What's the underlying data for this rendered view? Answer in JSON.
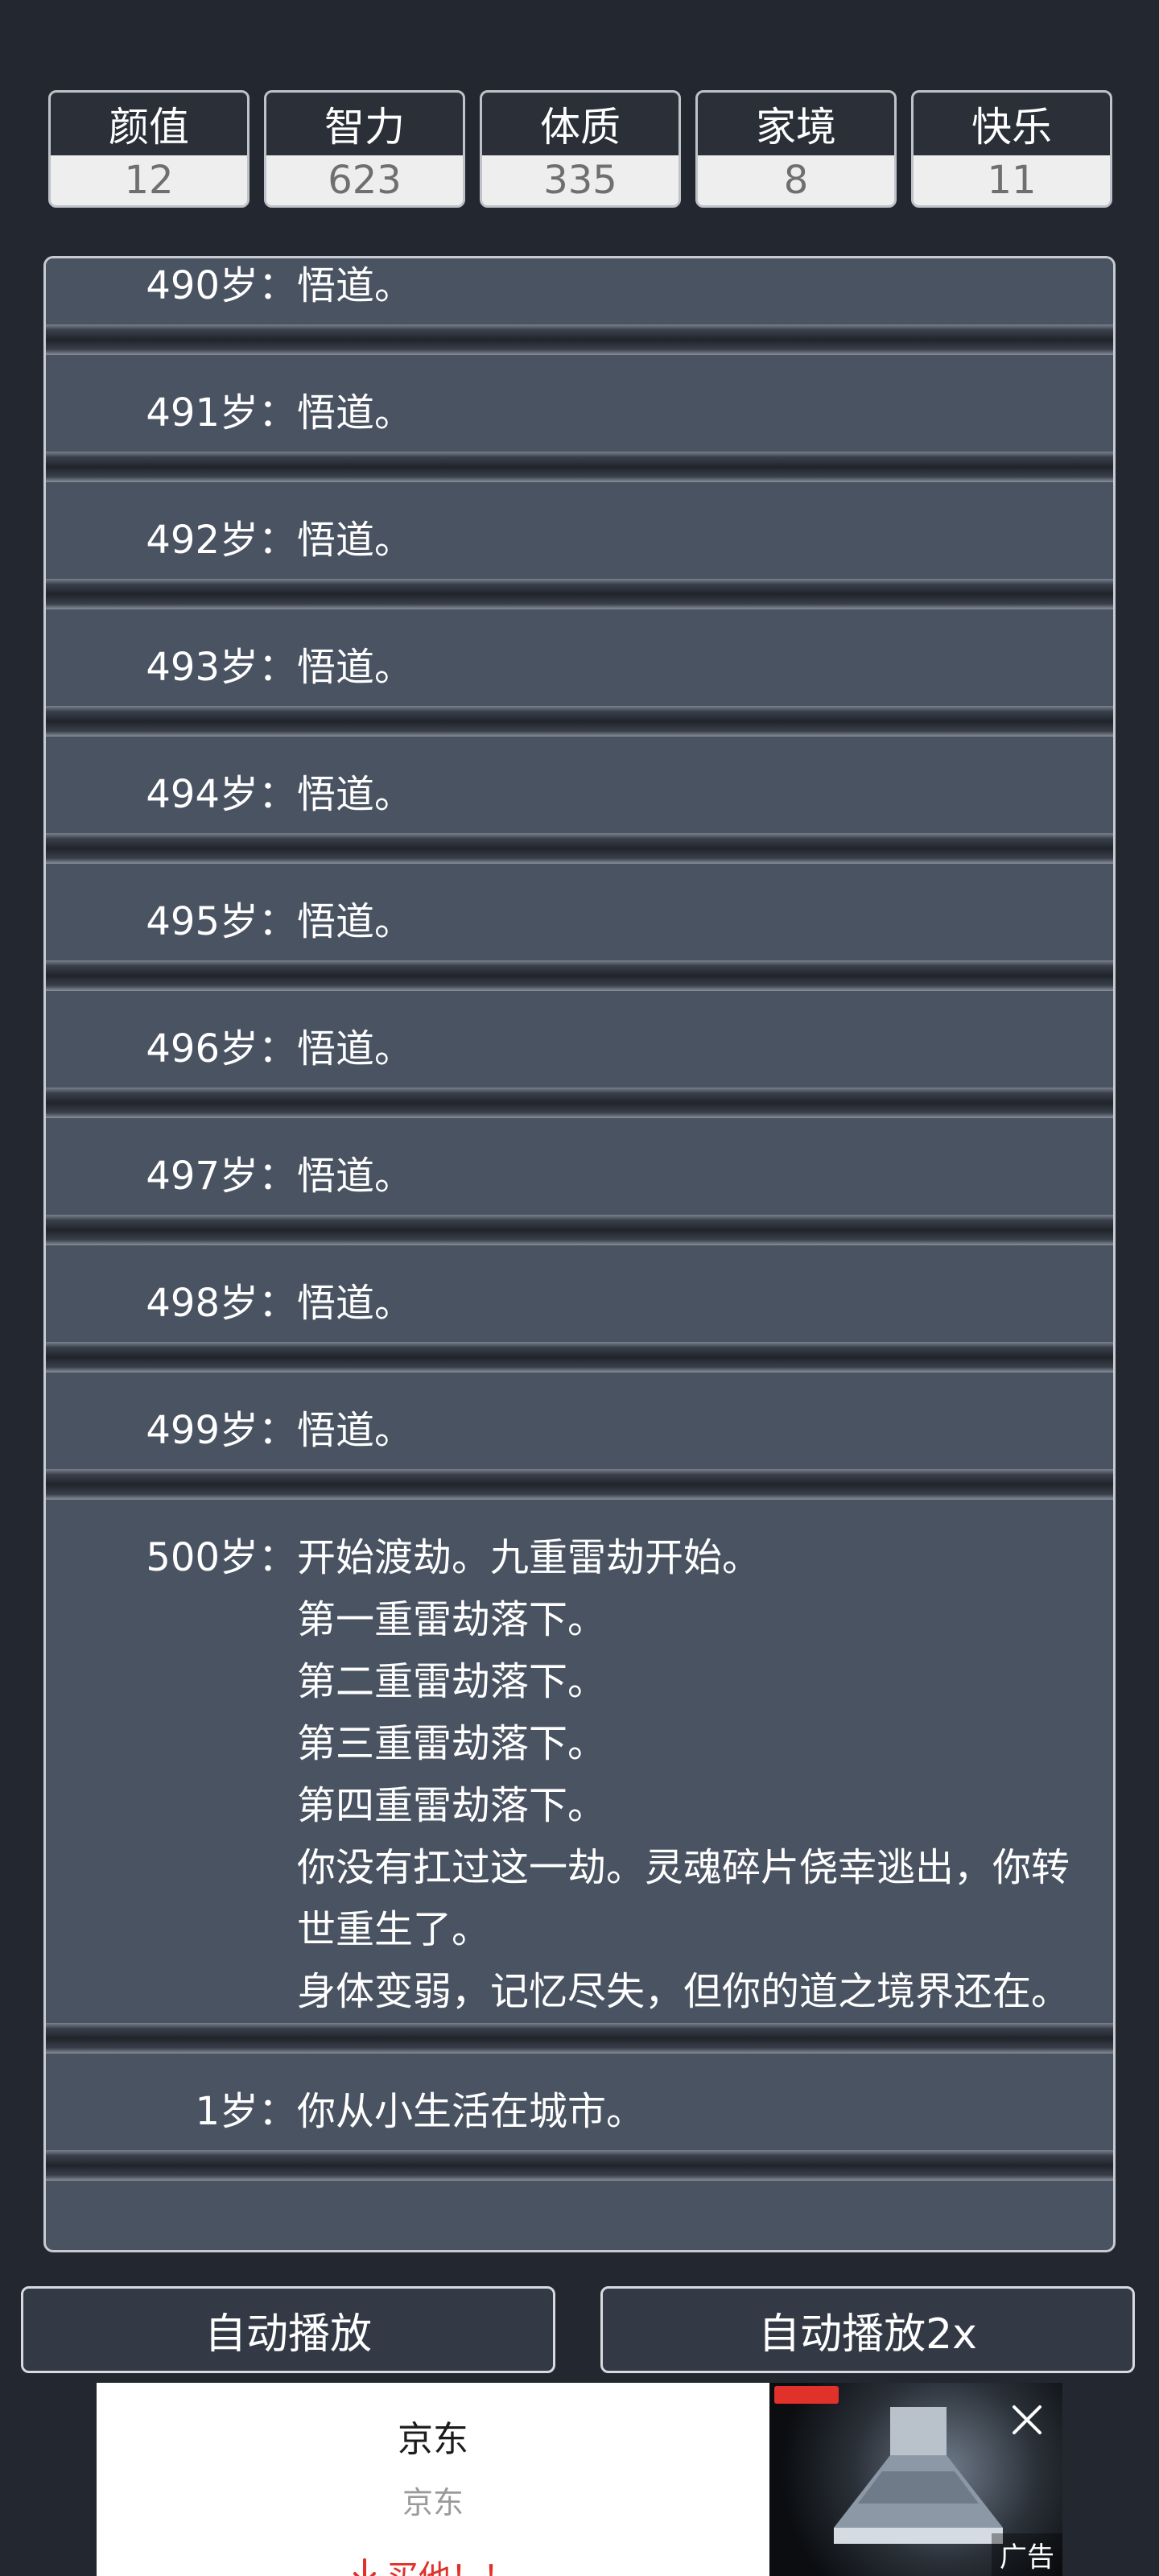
{
  "stats": [
    {
      "label": "颜值",
      "value": "12"
    },
    {
      "label": "智力",
      "value": "623"
    },
    {
      "label": "体质",
      "value": "335"
    },
    {
      "label": "家境",
      "value": "8"
    },
    {
      "label": "快乐",
      "value": "11"
    }
  ],
  "log": [
    {
      "age": "490岁：",
      "events": [
        "悟道。"
      ]
    },
    {
      "age": "491岁：",
      "events": [
        "悟道。"
      ]
    },
    {
      "age": "492岁：",
      "events": [
        "悟道。"
      ]
    },
    {
      "age": "493岁：",
      "events": [
        "悟道。"
      ]
    },
    {
      "age": "494岁：",
      "events": [
        "悟道。"
      ]
    },
    {
      "age": "495岁：",
      "events": [
        "悟道。"
      ]
    },
    {
      "age": "496岁：",
      "events": [
        "悟道。"
      ]
    },
    {
      "age": "497岁：",
      "events": [
        "悟道。"
      ]
    },
    {
      "age": "498岁：",
      "events": [
        "悟道。"
      ]
    },
    {
      "age": "499岁：",
      "events": [
        "悟道。"
      ]
    },
    {
      "age": "500岁：",
      "events": [
        "开始渡劫。九重雷劫开始。",
        "第一重雷劫落下。",
        "第二重雷劫落下。",
        "第三重雷劫落下。",
        "第四重雷劫落下。",
        "你没有扛过这一劫。灵魂碎片侥幸逃出，你转世重生了。",
        "身体变弱，记忆尽失，但你的道之境界还在。"
      ]
    },
    {
      "age": "1岁：",
      "events": [
        "你从小生活在城市。"
      ]
    }
  ],
  "controls": {
    "auto_play": "自动播放",
    "auto_play_2x": "自动播放2x"
  },
  "ad": {
    "title": "京东",
    "subtitle": "京东",
    "cta": "买他！！",
    "label": "广告"
  }
}
